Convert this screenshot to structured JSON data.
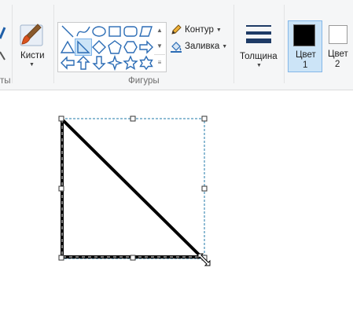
{
  "ribbon": {
    "brushes": {
      "label": "Кисти",
      "icon": "brush-icon"
    },
    "shapes": {
      "group_label": "Фигуры",
      "outline_label": "Контур",
      "fill_label": "Заливка",
      "selected_shape": "right-triangle"
    },
    "size": {
      "label": "Толщина"
    },
    "color1": {
      "label_line1": "Цвет",
      "label_line2": "1",
      "value": "#000000"
    },
    "color2": {
      "label_line1": "Цвет",
      "label_line2": "2",
      "value": "#ffffff"
    },
    "cropped_group_label": "ты"
  },
  "canvas": {
    "shape": "right-triangle",
    "stroke_color": "#000000",
    "selection_color": "#1f7aa8"
  }
}
